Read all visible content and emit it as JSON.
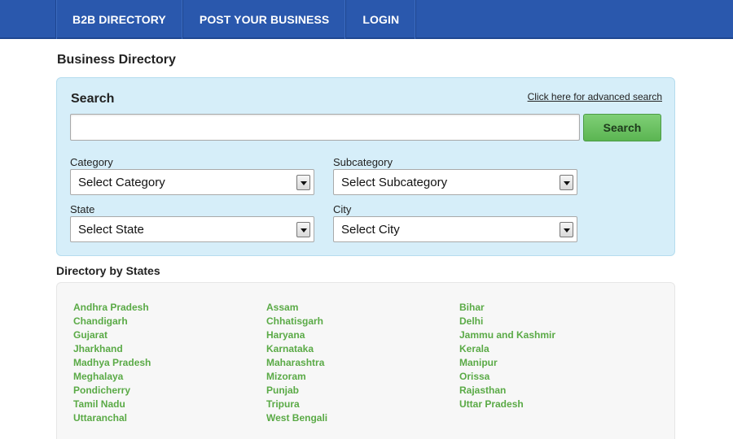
{
  "nav": {
    "items": [
      "B2B DIRECTORY",
      "POST YOUR BUSINESS",
      "LOGIN"
    ]
  },
  "page": {
    "title": "Business Directory"
  },
  "search": {
    "heading": "Search",
    "advanced_link": "Click here for advanced search",
    "input_value": "",
    "button_label": "Search",
    "category": {
      "label": "Category",
      "selected": "Select Category"
    },
    "subcategory": {
      "label": "Subcategory",
      "selected": "Select Subcategory"
    },
    "state": {
      "label": "State",
      "selected": "Select State"
    },
    "city": {
      "label": "City",
      "selected": "Select City"
    }
  },
  "directory": {
    "heading": "Directory by States",
    "columns": [
      [
        "Andhra Pradesh",
        "Chandigarh",
        "Gujarat",
        "Jharkhand",
        "Madhya Pradesh",
        "Meghalaya",
        "Pondicherry",
        "Tamil Nadu",
        "Uttaranchal"
      ],
      [
        "Assam",
        "Chhatisgarh",
        "Haryana",
        "Karnataka",
        "Maharashtra",
        "Mizoram",
        "Punjab",
        "Tripura",
        "West Bengali"
      ],
      [
        "Bihar",
        "Delhi",
        "Jammu and Kashmir",
        "Kerala",
        "Manipur",
        "Orissa",
        "Rajasthan",
        "Uttar Pradesh"
      ]
    ]
  },
  "colors": {
    "nav_bg": "#2a58ad",
    "panel_bg": "#d6eef9",
    "button_green": "#5bb552",
    "link_green": "#5aaa46"
  }
}
